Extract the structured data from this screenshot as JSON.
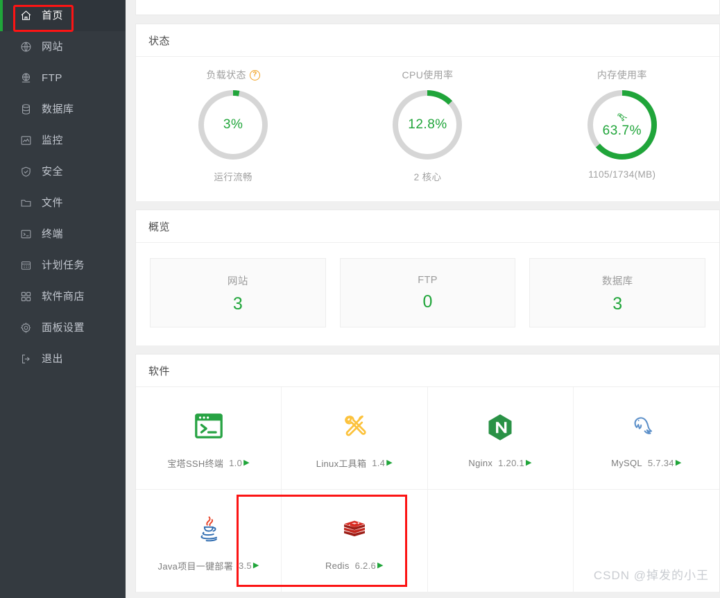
{
  "sidebar": {
    "items": [
      {
        "label": "首页",
        "icon": "home-icon",
        "active": true
      },
      {
        "label": "网站",
        "icon": "globe-icon",
        "active": false
      },
      {
        "label": "FTP",
        "icon": "ftp-icon",
        "active": false
      },
      {
        "label": "数据库",
        "icon": "database-icon",
        "active": false
      },
      {
        "label": "监控",
        "icon": "monitor-icon",
        "active": false
      },
      {
        "label": "安全",
        "icon": "shield-icon",
        "active": false
      },
      {
        "label": "文件",
        "icon": "folder-icon",
        "active": false
      },
      {
        "label": "终端",
        "icon": "terminal-icon",
        "active": false
      },
      {
        "label": "计划任务",
        "icon": "calendar-icon",
        "active": false
      },
      {
        "label": "软件商店",
        "icon": "grid-icon",
        "active": false
      },
      {
        "label": "面板设置",
        "icon": "gear-icon",
        "active": false
      },
      {
        "label": "退出",
        "icon": "logout-icon",
        "active": false
      }
    ]
  },
  "status": {
    "title": "状态",
    "gauges": [
      {
        "caption": "负载状态",
        "has_help": true,
        "value": "3%",
        "percent": 3,
        "sub": "运行流畅",
        "rocket": false
      },
      {
        "caption": "CPU使用率",
        "has_help": false,
        "value": "12.8%",
        "percent": 12.8,
        "sub": "2 核心",
        "rocket": false
      },
      {
        "caption": "内存使用率",
        "has_help": false,
        "value": "63.7%",
        "percent": 63.7,
        "sub": "1105/1734(MB)",
        "rocket": true
      }
    ]
  },
  "overview": {
    "title": "概览",
    "boxes": [
      {
        "name": "网站",
        "count": "3"
      },
      {
        "name": "FTP",
        "count": "0"
      },
      {
        "name": "数据库",
        "count": "3"
      }
    ]
  },
  "software": {
    "title": "软件",
    "items": [
      {
        "name": "宝塔SSH终端",
        "version": "1.0",
        "icon": "terminal-window-icon"
      },
      {
        "name": "Linux工具箱",
        "version": "1.4",
        "icon": "tools-icon"
      },
      {
        "name": "Nginx",
        "version": "1.20.1",
        "icon": "nginx-icon"
      },
      {
        "name": "MySQL",
        "version": "5.7.34",
        "icon": "mysql-dolphin-icon"
      },
      {
        "name": "Java项目一键部署",
        "version": "3.5",
        "icon": "java-icon"
      },
      {
        "name": "Redis",
        "version": "6.2.6",
        "icon": "redis-icon"
      },
      {
        "name": "",
        "version": "",
        "icon": ""
      },
      {
        "name": "",
        "version": "",
        "icon": ""
      }
    ],
    "play_glyph": "▶"
  },
  "watermark": "CSDN @掉发的小王",
  "colors": {
    "accent_green": "#20a53a",
    "sidebar_bg": "#343a40",
    "highlight_red": "#fc1414",
    "ring_track": "#d6d6d6",
    "muted_text": "#a0a0a0"
  }
}
